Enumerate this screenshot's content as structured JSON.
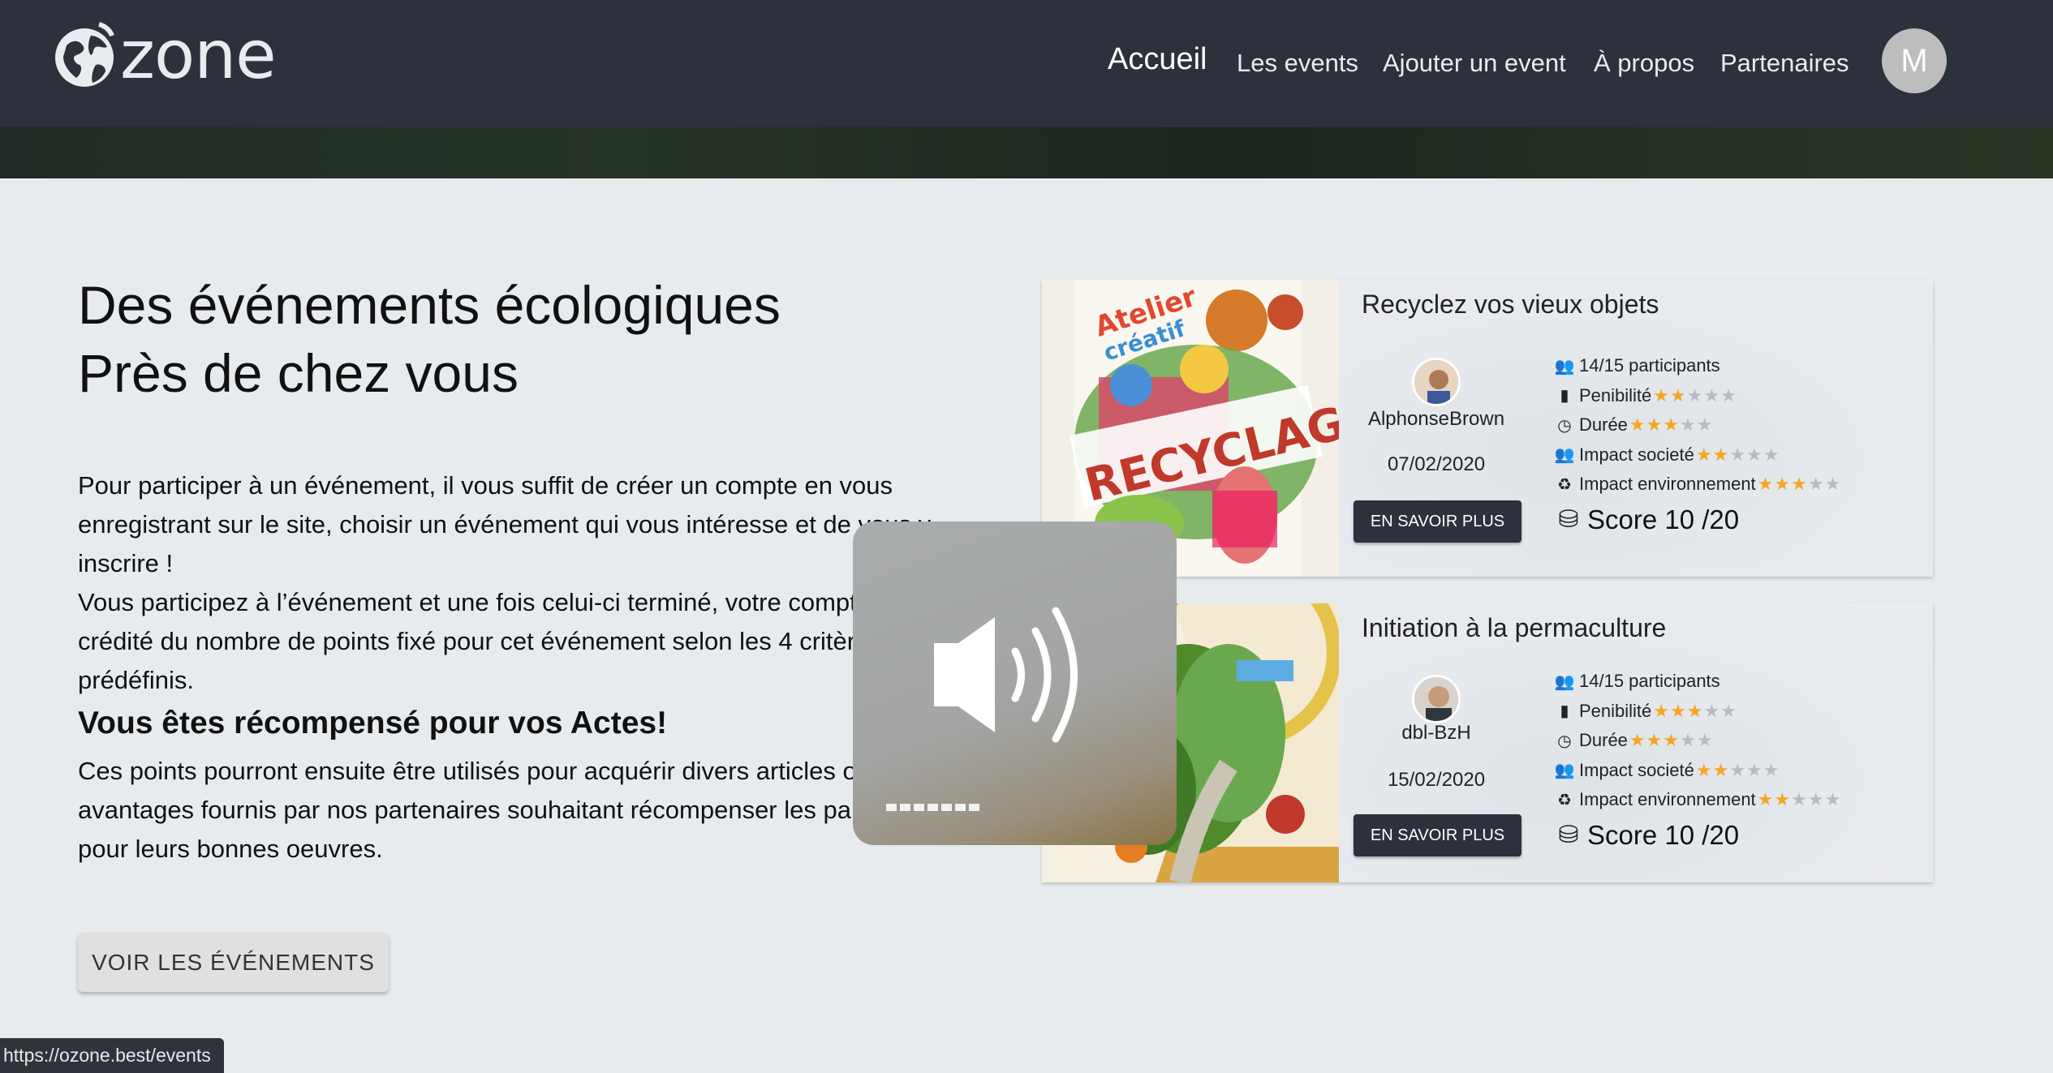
{
  "navbar": {
    "logo_text": "zone",
    "links": [
      {
        "label": "Accueil",
        "active": true
      },
      {
        "label": "Les events"
      },
      {
        "label": "Ajouter un event"
      },
      {
        "label": "À propos"
      },
      {
        "label": "Partenaires"
      }
    ],
    "avatar_letter": "M"
  },
  "hero": {
    "heading_line1": "Des événements écologiques",
    "heading_line2": "Près de chez vous",
    "para1": "Pour participer à un événement, il vous suffit de créer un compte en vous enregistrant sur le site, choisir un événement qui vous intéresse et de vous y inscrire !",
    "para2": "Vous participez à l’événement et une fois celui-ci terminé, votre compte sera crédité du nombre de points fixé pour cet événement selon les 4 critères prédéfinis.",
    "subheading": "Vous êtes récompensé pour vos Actes!",
    "para3": "Ces points pourront ensuite être utilisés pour acquérir divers articles ou avantages fournis par nos partenaires souhaitant récompenser les participants pour leurs bonnes oeuvres.",
    "button_label": "VOIR LES ÉVÉNEMENTS"
  },
  "events": [
    {
      "title": "Recyclez vos vieux objets",
      "author": "AlphonseBrown",
      "date": "07/02/2020",
      "button_label": "EN SAVOIR PLUS",
      "participants": "14/15 participants",
      "penibilite_label": "Penibilité",
      "penibilite": 2,
      "duree_label": "Durée",
      "duree": 3,
      "impact_societe_label": "Impact societé",
      "impact_societe": 2,
      "impact_env_label": "Impact environnement",
      "impact_env": 3,
      "score": "Score 10 /20",
      "image_text": "RECYCLAGE"
    },
    {
      "title": "Initiation à la permaculture",
      "author": "dbl-BzH",
      "date": "15/02/2020",
      "button_label": "EN SAVOIR PLUS",
      "participants": "14/15 participants",
      "penibilite_label": "Penibilité",
      "penibilite": 3,
      "duree_label": "Durée",
      "duree": 3,
      "impact_societe_label": "Impact societé",
      "impact_societe": 2,
      "impact_env_label": "Impact environnement",
      "impact_env": 2,
      "score": "Score 10 /20"
    }
  ],
  "volume_overlay": {
    "level": 0.45,
    "icon": "speaker-volume-icon"
  },
  "status_bar": {
    "url": "https://ozone.best/events"
  },
  "colors": {
    "navbar": "#2c313c",
    "star": "#f5a623",
    "page_bg": "#e8ebee"
  }
}
